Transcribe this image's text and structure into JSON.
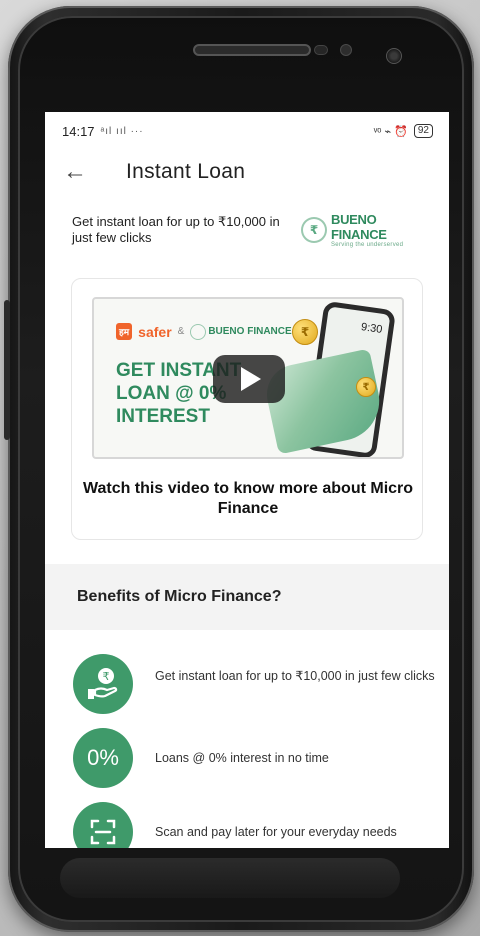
{
  "status_bar": {
    "time": "14:17",
    "signal": "ᵃıl ııl ···",
    "right_icons": "ᵛᵒ ⌁ ⏰",
    "battery": "92"
  },
  "app_bar": {
    "back_icon": "arrow-left-icon",
    "title": "Instant Loan"
  },
  "intro": {
    "text": "Get instant loan for up to ₹10,000 in just few clicks",
    "brand_name": "BUENO FINANCE",
    "brand_tagline": "Serving the underserved"
  },
  "video": {
    "thumb_brand1_badge": "हम",
    "thumb_brand1": "safer",
    "thumb_amp": "&",
    "thumb_brand2": "BUENO FINANCE",
    "headline": "GET INSTANT LOAN @ 0% INTEREST",
    "phone_time": "9:30",
    "coin_symbol": "₹",
    "caption": "Watch this video to know more about Micro Finance"
  },
  "benefits": {
    "title": "Benefits of Micro Finance?",
    "items": [
      {
        "icon": "hand-rupee-icon",
        "icon_text": "₹",
        "text": "Get instant loan for up to ₹10,000 in just few clicks"
      },
      {
        "icon": "percent-icon",
        "icon_text": "0%",
        "text": "Loans @ 0% interest in no time"
      },
      {
        "icon": "scan-icon",
        "icon_text": "",
        "text": "Scan and pay later for your everyday needs"
      }
    ]
  },
  "colors": {
    "accent_green": "#3f9a6a",
    "brand_green": "#2f8a5e",
    "safer_orange": "#f0642b"
  }
}
